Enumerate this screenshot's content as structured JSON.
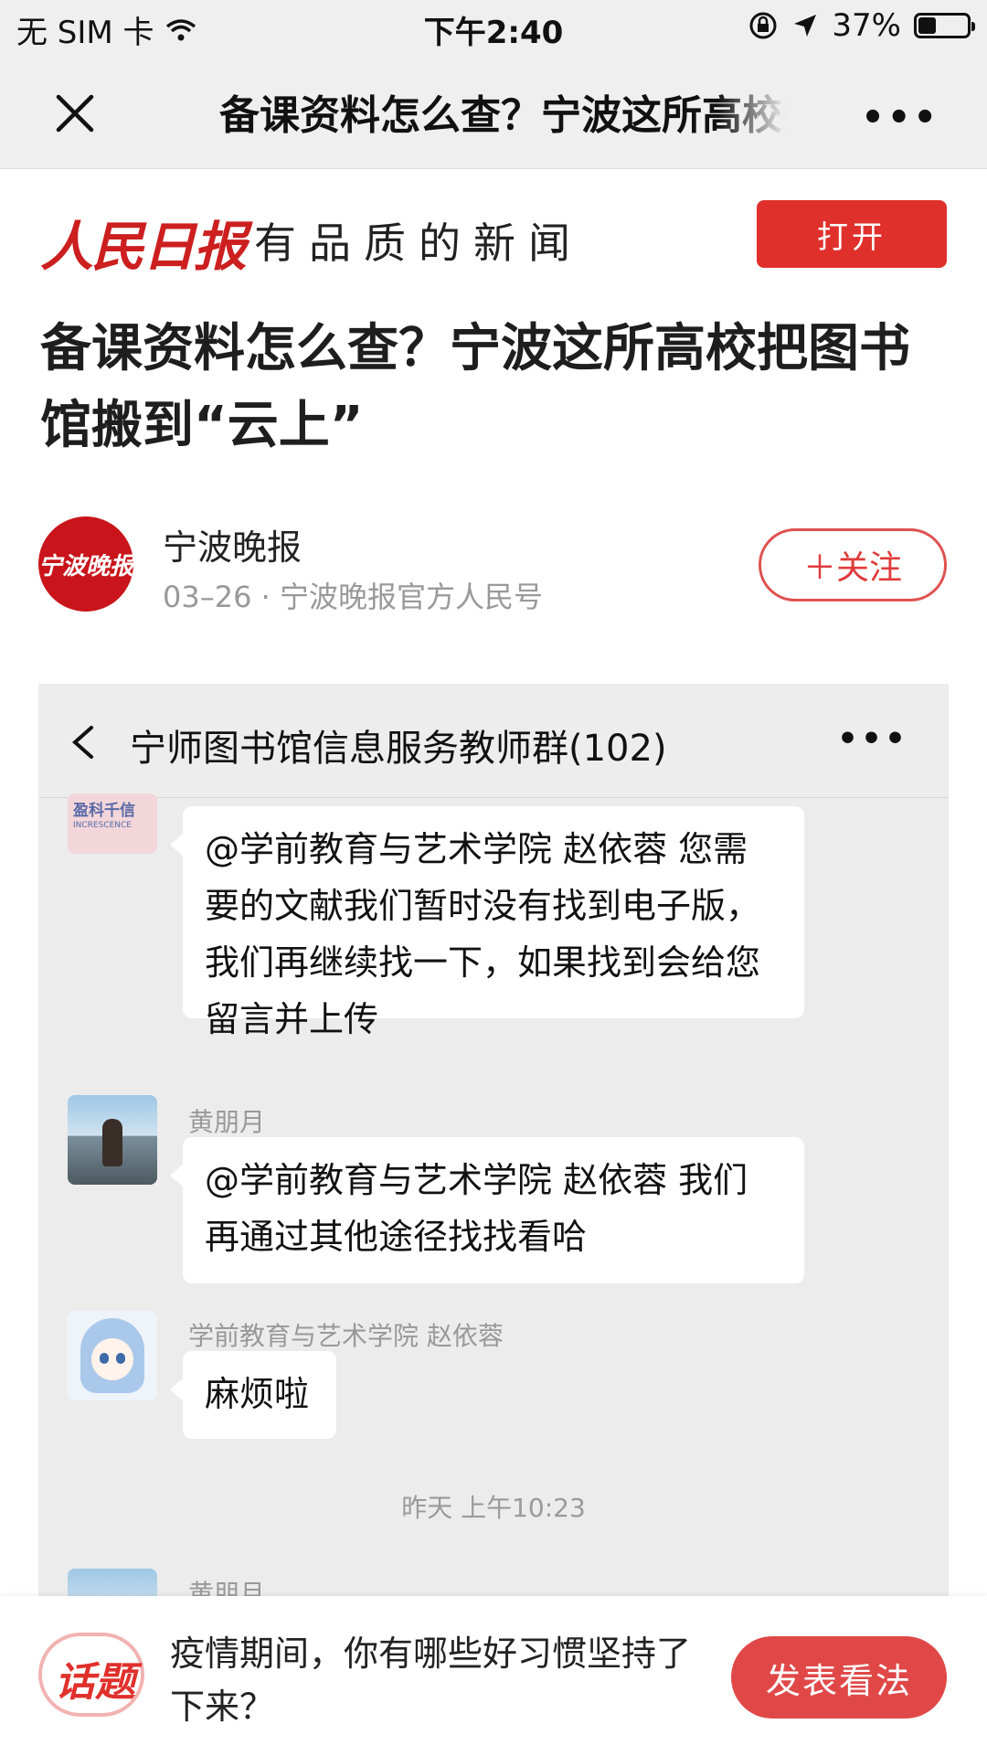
{
  "status_bar": {
    "carrier": "无 SIM 卡",
    "time": "下午2:40",
    "battery_percent": "37%",
    "battery_level": 0.37
  },
  "title_bar": {
    "title": "备课资料怎么查？宁波这所高校把图书馆搬到“云上”"
  },
  "brand": {
    "logo_text": "人民日报",
    "slogan": "有品质的新闻",
    "open_label": "打开"
  },
  "article": {
    "headline": "备课资料怎么查？宁波这所高校把图书馆搬到“云上”",
    "author": {
      "avatar_text": "宁波晚报",
      "name": "宁波晚报",
      "meta": "03–26 · 宁波晚报官方人民号",
      "follow_label": "＋关注"
    }
  },
  "chat": {
    "title": "宁师图书馆信息服务教师群(102)",
    "messages": [
      {
        "avatar_logo": "盈科千信",
        "avatar_sub": "INCRESCENCE",
        "text": "@学前教育与艺术学院 赵依蓉 您需要的文献我们暂时没有找到电子版，我们再继续找一下，如果找到会给您留言并上传"
      },
      {
        "sender": "黄朋月",
        "text": "@学前教育与艺术学院 赵依蓉  我们再通过其他途径找找看哈"
      },
      {
        "sender": "学前教育与艺术学院 赵依蓉",
        "text": "麻烦啦"
      }
    ],
    "timestamp": "昨天 上午10:23",
    "next_sender": "黄朋月"
  },
  "topic": {
    "icon_text": "话题",
    "question": "疫情期间，你有哪些好习惯坚持了下来？",
    "button_label": "发表看法"
  }
}
